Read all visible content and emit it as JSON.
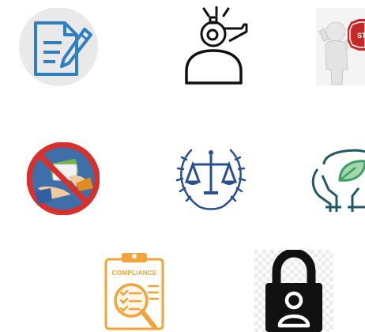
{
  "icons": [
    {
      "name": "document-edit-icon"
    },
    {
      "name": "whistleblower-icon"
    },
    {
      "name": "stop-sign-figure-icon"
    },
    {
      "name": "no-bribery-icon"
    },
    {
      "name": "justice-scales-icon"
    },
    {
      "name": "hands-leaf-icon"
    },
    {
      "name": "compliance-clipboard-icon"
    },
    {
      "name": "padlock-user-icon"
    }
  ],
  "labels": {
    "stop_sign": "STO",
    "compliance": "COMPLIANCE"
  },
  "colors": {
    "doc_blue": "#2f7fc1",
    "doc_bg": "#e9e9ea",
    "stop_red": "#c62828",
    "no_red": "#d9302c",
    "money_green": "#6fb64a",
    "scales_blue": "#2a4f8f",
    "leaf_green": "#3aa06a",
    "hands_teal": "#1f5b64",
    "compliance_orange": "#f2a33a",
    "lock_black": "#111111"
  }
}
